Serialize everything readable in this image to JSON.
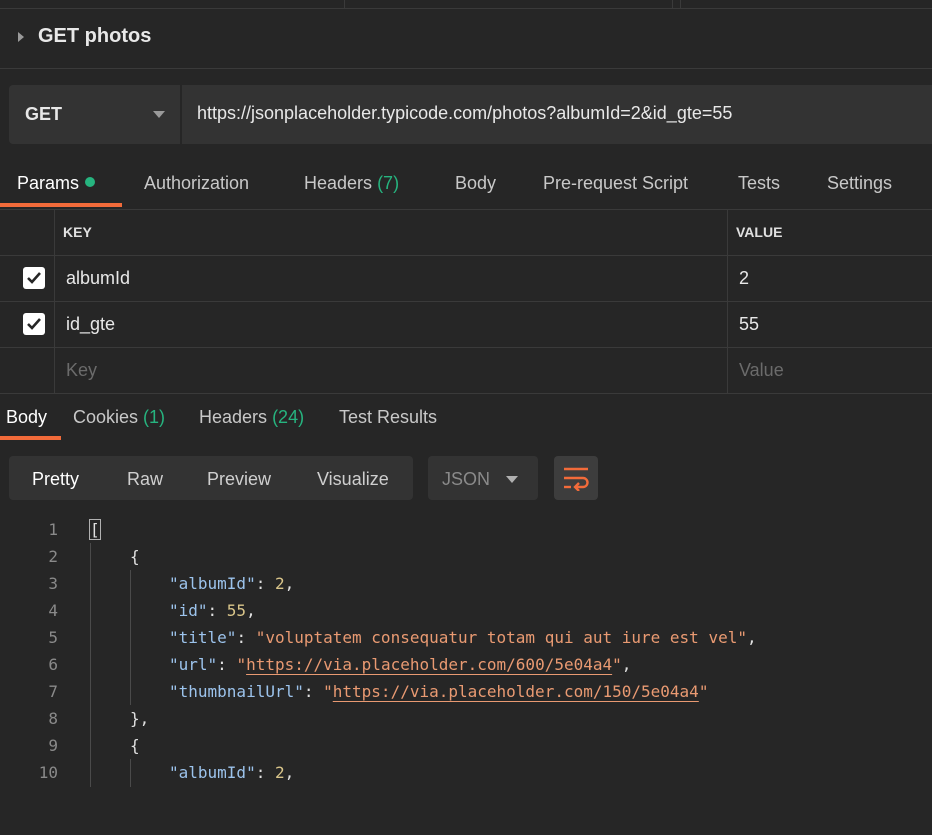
{
  "request": {
    "name": "GET photos",
    "method": "GET",
    "url": "https://jsonplaceholder.typicode.com/photos?albumId=2&id_gte=55"
  },
  "request_tabs": [
    {
      "label": "Params",
      "count": "",
      "active": true
    },
    {
      "label": "Authorization",
      "count": ""
    },
    {
      "label": "Headers",
      "count": "(7)"
    },
    {
      "label": "Body",
      "count": ""
    },
    {
      "label": "Pre-request Script",
      "count": ""
    },
    {
      "label": "Tests",
      "count": ""
    },
    {
      "label": "Settings",
      "count": ""
    }
  ],
  "params": {
    "key_header": "KEY",
    "value_header": "VALUE",
    "rows": [
      {
        "key": "albumId",
        "value": "2",
        "checked": true
      },
      {
        "key": "id_gte",
        "value": "55",
        "checked": true
      }
    ],
    "key_placeholder": "Key",
    "value_placeholder": "Value"
  },
  "response_tabs": [
    {
      "label": "Body",
      "count": "",
      "active": true
    },
    {
      "label": "Cookies",
      "count": "(1)"
    },
    {
      "label": "Headers",
      "count": "(24)"
    },
    {
      "label": "Test Results",
      "count": ""
    }
  ],
  "format_buttons": [
    "Pretty",
    "Raw",
    "Preview",
    "Visualize"
  ],
  "format_active": "Pretty",
  "language": "JSON",
  "code_lines": [
    {
      "n": "1",
      "open": "["
    },
    {
      "n": "2",
      "open": "{"
    },
    {
      "n": "3",
      "key": "\"albumId\"",
      "num": "2"
    },
    {
      "n": "4",
      "key": "\"id\"",
      "num": "55"
    },
    {
      "n": "5",
      "key": "\"title\"",
      "str": "\"voluptatem consequatur totam qui aut iure est vel\""
    },
    {
      "n": "6",
      "key": "\"url\"",
      "link": "https://via.placeholder.com/600/5e04a4"
    },
    {
      "n": "7",
      "key": "\"thumbnailUrl\"",
      "link": "https://via.placeholder.com/150/5e04a4"
    },
    {
      "n": "8",
      "close": "},"
    },
    {
      "n": "9",
      "open": "{"
    },
    {
      "n": "10",
      "key": "\"albumId\"",
      "num": "2"
    }
  ],
  "colors": {
    "accent": "#f26b3a",
    "count_green": "#26b47f",
    "background": "#262626",
    "json_key": "#9cc3ec",
    "json_number": "#d9c58a",
    "json_string": "#e99a72"
  }
}
